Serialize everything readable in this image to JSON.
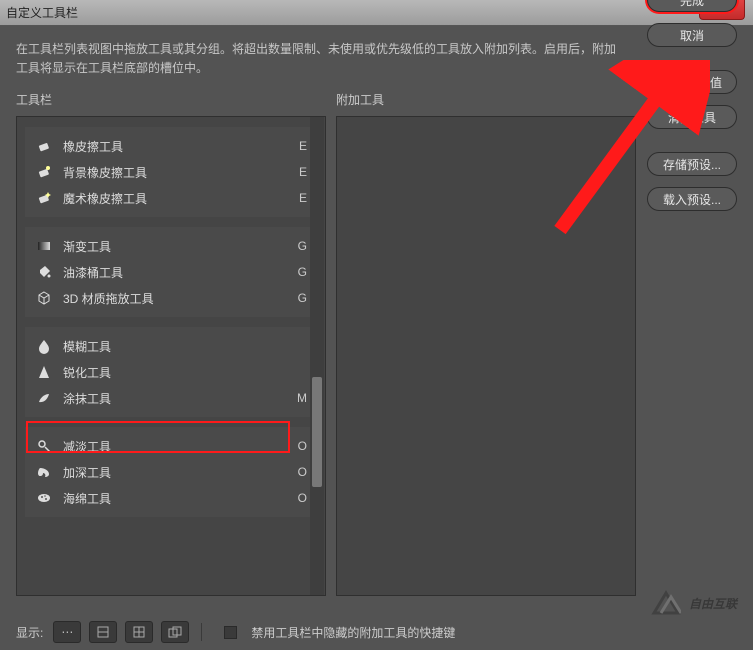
{
  "title": "自定义工具栏",
  "close_x": "×",
  "instructions": "在工具栏列表视图中拖放工具或其分组。将超出数量限制、未使用或优先级低的工具放入附加列表。启用后，附加工具将显示在工具栏底部的槽位中。",
  "left_title": "工具栏",
  "mid_title": "附加工具",
  "tool_groups": [
    {
      "tools": [
        {
          "icon": "eraser",
          "label": "橡皮擦工具",
          "key": "E"
        },
        {
          "icon": "bg-eraser",
          "label": "背景橡皮擦工具",
          "key": "E"
        },
        {
          "icon": "magic-eraser",
          "label": "魔术橡皮擦工具",
          "key": "E"
        }
      ]
    },
    {
      "tools": [
        {
          "icon": "gradient",
          "label": "渐变工具",
          "key": "G"
        },
        {
          "icon": "bucket",
          "label": "油漆桶工具",
          "key": "G"
        },
        {
          "icon": "3d",
          "label": "3D 材质拖放工具",
          "key": "G"
        }
      ]
    },
    {
      "tools": [
        {
          "icon": "blur",
          "label": "模糊工具",
          "key": ""
        },
        {
          "icon": "sharpen",
          "label": "锐化工具",
          "key": ""
        },
        {
          "icon": "smudge",
          "label": "涂抹工具",
          "key": "M",
          "highlighted": true
        }
      ]
    },
    {
      "tools": [
        {
          "icon": "dodge",
          "label": "减淡工具",
          "key": "O"
        },
        {
          "icon": "burn",
          "label": "加深工具",
          "key": "O"
        },
        {
          "icon": "sponge",
          "label": "海绵工具",
          "key": "O"
        }
      ]
    }
  ],
  "buttons": {
    "done": "完成",
    "cancel": "取消",
    "restore": "恢复默认值",
    "clear": "清除工具",
    "save_preset": "存储预设...",
    "load_preset": "载入预设..."
  },
  "footer": {
    "show_label": "显示:",
    "checkbox_label": "禁用工具栏中隐藏的附加工具的快捷键"
  },
  "watermark": "自由互联"
}
